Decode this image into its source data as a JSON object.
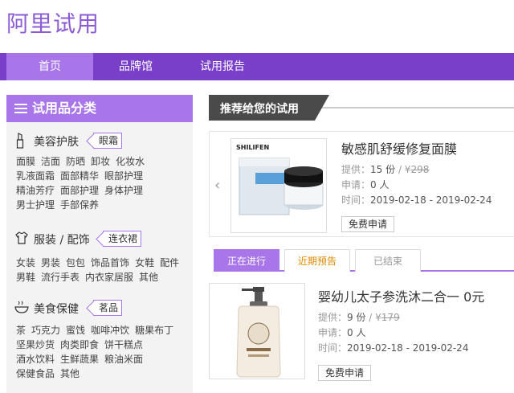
{
  "header": {
    "logo": "阿里试用"
  },
  "nav": {
    "items": [
      "首页",
      "品牌馆",
      "试用报告"
    ],
    "active_index": 0
  },
  "sidebar": {
    "title": "试用品分类",
    "categories": [
      {
        "name": "美容护肤",
        "tag": "眼霜",
        "icon": "lipstick-icon",
        "links": [
          [
            "面膜",
            "洁面",
            "防晒",
            "卸妆",
            "化妆水"
          ],
          [
            "乳液面霜",
            "面部精华",
            "眼部护理"
          ],
          [
            "精油芳疗",
            "面部护理",
            "身体护理"
          ],
          [
            "男士护理",
            "手部保养"
          ]
        ]
      },
      {
        "name": "服装 / 配饰",
        "tag": "连衣裙",
        "icon": "tshirt-icon",
        "links": [
          [
            "女装",
            "男装",
            "包包",
            "饰品首饰",
            "女鞋",
            "配件"
          ],
          [
            "男鞋",
            "流行手表",
            "内衣家居服",
            "其他"
          ]
        ]
      },
      {
        "name": "美食保健",
        "tag": "茗品",
        "icon": "bowl-icon",
        "links": [
          [
            "茶",
            "巧克力",
            "蜜饯",
            "咖啡冲饮",
            "糖果布丁"
          ],
          [
            "坚果炒货",
            "肉类即食",
            "饼干糕点"
          ],
          [
            "酒水饮料",
            "生鲜蔬果",
            "粮油米面"
          ],
          [
            "保健食品",
            "其他"
          ]
        ]
      }
    ]
  },
  "recommend": {
    "title": "推荐给您的试用",
    "product": {
      "title": "敏感肌舒缓修复面膜",
      "brand": "SHILIFEN",
      "supply_label": "提供：",
      "supply_value": "15 份",
      "price_prefix": "/ ¥",
      "price": "298",
      "apply_label": "申请：",
      "apply_value": "0 人",
      "time_label": "时间：",
      "time_value": "2019-02-18 - 2019-02-24",
      "button": "免费申请"
    }
  },
  "tabs": {
    "items": [
      "正在进行",
      "近期预告",
      "已结束"
    ],
    "active_index": 0
  },
  "listing": {
    "product": {
      "title": "婴幼儿太子参洗沐二合一 0元",
      "supply_label": "提供：",
      "supply_value": "9 份",
      "price_prefix": "/ ¥",
      "price": "179",
      "apply_label": "申请：",
      "apply_value": "0 人",
      "time_label": "时间：",
      "time_value": "2019-02-18 - 2019-02-24",
      "button": "免费申请"
    }
  },
  "colors": {
    "brand": "#7a3fc8",
    "accent": "#a876e8",
    "upcoming": "#e08a00"
  }
}
